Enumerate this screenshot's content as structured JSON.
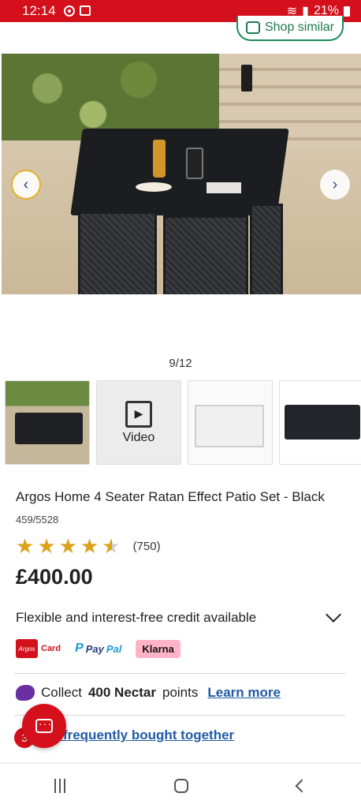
{
  "status_bar": {
    "time": "12:14",
    "battery": "21%"
  },
  "header": {
    "shop_similar_label": "Shop similar"
  },
  "gallery": {
    "counter": "9/12",
    "prev_icon": "chevron-left-icon",
    "next_icon": "chevron-right-icon",
    "thumbnails": [
      {
        "kind": "image",
        "name": "patio-set-garden"
      },
      {
        "kind": "video",
        "label": "Video"
      },
      {
        "kind": "image",
        "name": "patio-set-dimensions"
      },
      {
        "kind": "image",
        "name": "patio-set-white-cushions"
      }
    ]
  },
  "product": {
    "title": "Argos Home 4 Seater Ratan Effect Patio Set - Black",
    "sku": "459/5528",
    "rating": 4.5,
    "review_count": "(750)",
    "price": "£400.00"
  },
  "credit": {
    "text": "Flexible and interest-free credit available",
    "argos_card_label": "Card",
    "argos_badge": "Argos",
    "paypal_label_a": "Pay",
    "paypal_label_b": "Pal",
    "klarna_label": "Klarna"
  },
  "nectar": {
    "prefix": "Collect",
    "points": "400 Nectar",
    "suffix": "points",
    "link": "Learn more"
  },
  "bought_together": {
    "link": "w frequently bought together",
    "badge": "3"
  },
  "colors": {
    "argos_red": "#d4101c",
    "link_blue": "#1f5aa6",
    "star_gold": "#d9a21b",
    "shop_similar_green": "#1b7a4b"
  }
}
